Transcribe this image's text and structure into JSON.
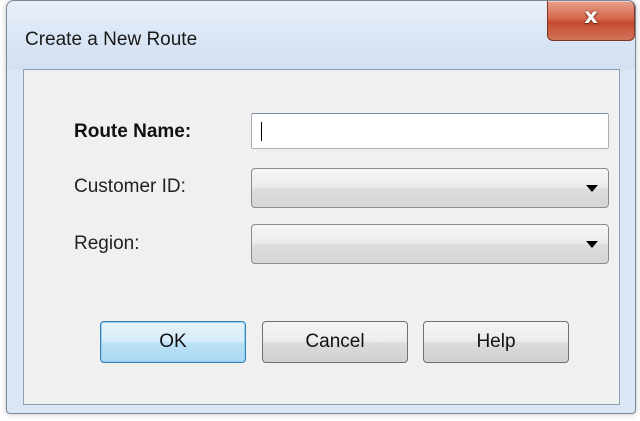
{
  "window": {
    "title": "Create a New Route",
    "close_glyph": "x",
    "close_icon": "close-icon"
  },
  "form": {
    "route_name": {
      "label": "Route Name:",
      "value": ""
    },
    "customer_id": {
      "label": "Customer ID:",
      "selected": ""
    },
    "region": {
      "label": "Region:",
      "selected": ""
    }
  },
  "buttons": {
    "ok": "OK",
    "cancel": "Cancel",
    "help": "Help"
  }
}
